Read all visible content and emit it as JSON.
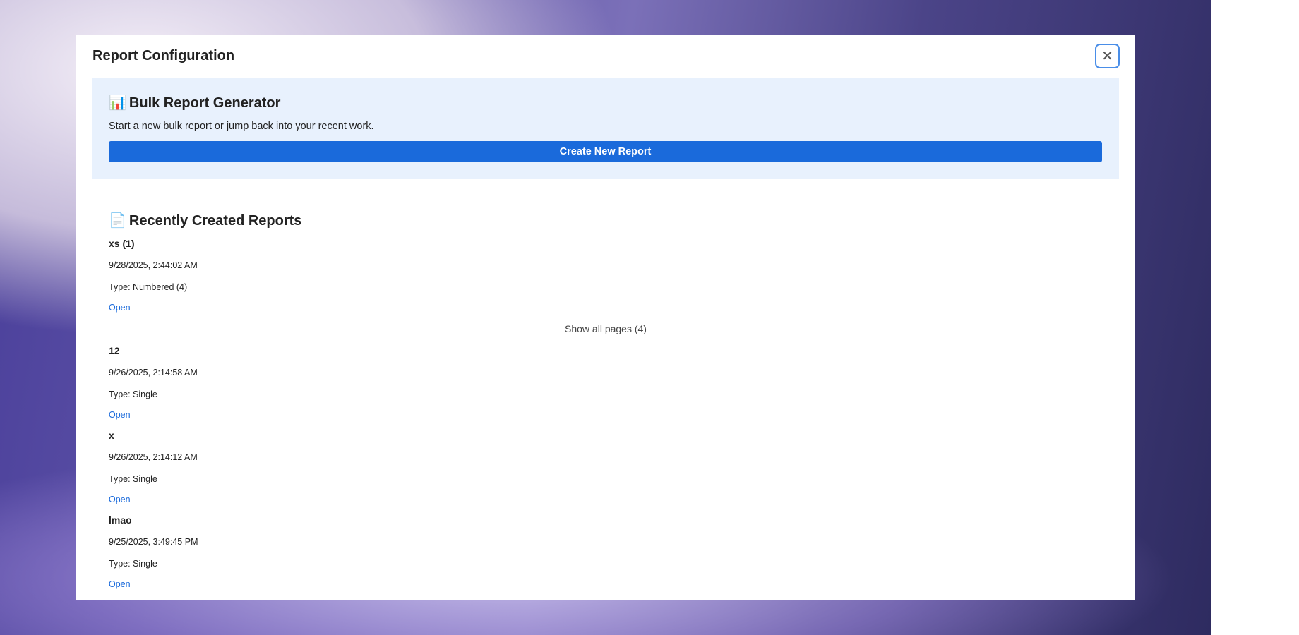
{
  "modal": {
    "title": "Report Configuration",
    "close_icon": "close-icon"
  },
  "generator": {
    "icon": "bar-chart-icon",
    "icon_glyph": "📊",
    "title": "Bulk Report Generator",
    "description": "Start a new bulk report or jump back into your recent work.",
    "create_label": "Create New Report"
  },
  "recent": {
    "icon": "document-icon",
    "icon_glyph": "📄",
    "title": "Recently Created Reports",
    "show_all_label": "Show all pages (4)",
    "items": [
      {
        "name": "xs (1)",
        "date": "9/28/2025, 2:44:02 AM",
        "type": "Type: Numbered (4)",
        "open": "Open"
      },
      {
        "name": "12",
        "date": "9/26/2025, 2:14:58 AM",
        "type": "Type: Single",
        "open": "Open"
      },
      {
        "name": "x",
        "date": "9/26/2025, 2:14:12 AM",
        "type": "Type: Single",
        "open": "Open"
      },
      {
        "name": "lmao",
        "date": "9/25/2025, 3:49:45 PM",
        "type": "Type: Single",
        "open": "Open"
      }
    ]
  },
  "colors": {
    "accent": "#1a6adb",
    "panel_bg": "#e8f1fd"
  }
}
